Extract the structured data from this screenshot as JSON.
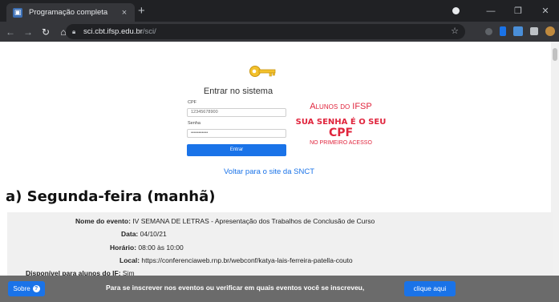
{
  "browser": {
    "tab_title": "Programação completa",
    "tab_close": "×",
    "new_tab": "+",
    "url_host": "sci.cbt.ifsp.edu.br",
    "url_path": "/sci/",
    "controls": {
      "minimize": "—",
      "maximize": "❐",
      "close": "✕"
    }
  },
  "login": {
    "title": "Entrar no sistema",
    "cpf_label": "CPF",
    "cpf_value": "12345678900",
    "senha_label": "Senha",
    "senha_value": "•••••••••••",
    "submit_label": "Entrar",
    "notice_line1": "Alunos do IFSP",
    "notice_line2": "SUA SENHA É O SEU ",
    "notice_line2_cpf": "CPF",
    "notice_line3": "NO PRIMEIRO ACESSO",
    "back_link": "Voltar para o site da SNCT"
  },
  "schedule": {
    "heading": "a) Segunda-feira (manhã)",
    "event": {
      "name_label": "Nome do evento:",
      "name_value": " IV SEMANA DE LETRAS - Apresentação dos Trabalhos de Conclusão de Curso",
      "date_label": "Data:",
      "date_value": " 04/10/21",
      "time_label": "Horário:",
      "time_value": " 08:00 às 10:00",
      "place_label": "Local:",
      "place_value": " https://conferenciaweb.rnp.br/webconf/katya-lais-ferreira-patella-couto",
      "available_label": "Disponível para alunos do IF:",
      "available_value": " Sim"
    }
  },
  "bottom_bar": {
    "about_label": "Sobre",
    "message": "Para se inscrever nos eventos ou verificar em quais eventos você se inscreveu,",
    "action_label": "clique aqui"
  },
  "colors": {
    "accent": "#1a73e8",
    "notice_red": "#e0253d",
    "chrome_dark": "#202124",
    "bottom_bar": "#6b6b6b"
  }
}
